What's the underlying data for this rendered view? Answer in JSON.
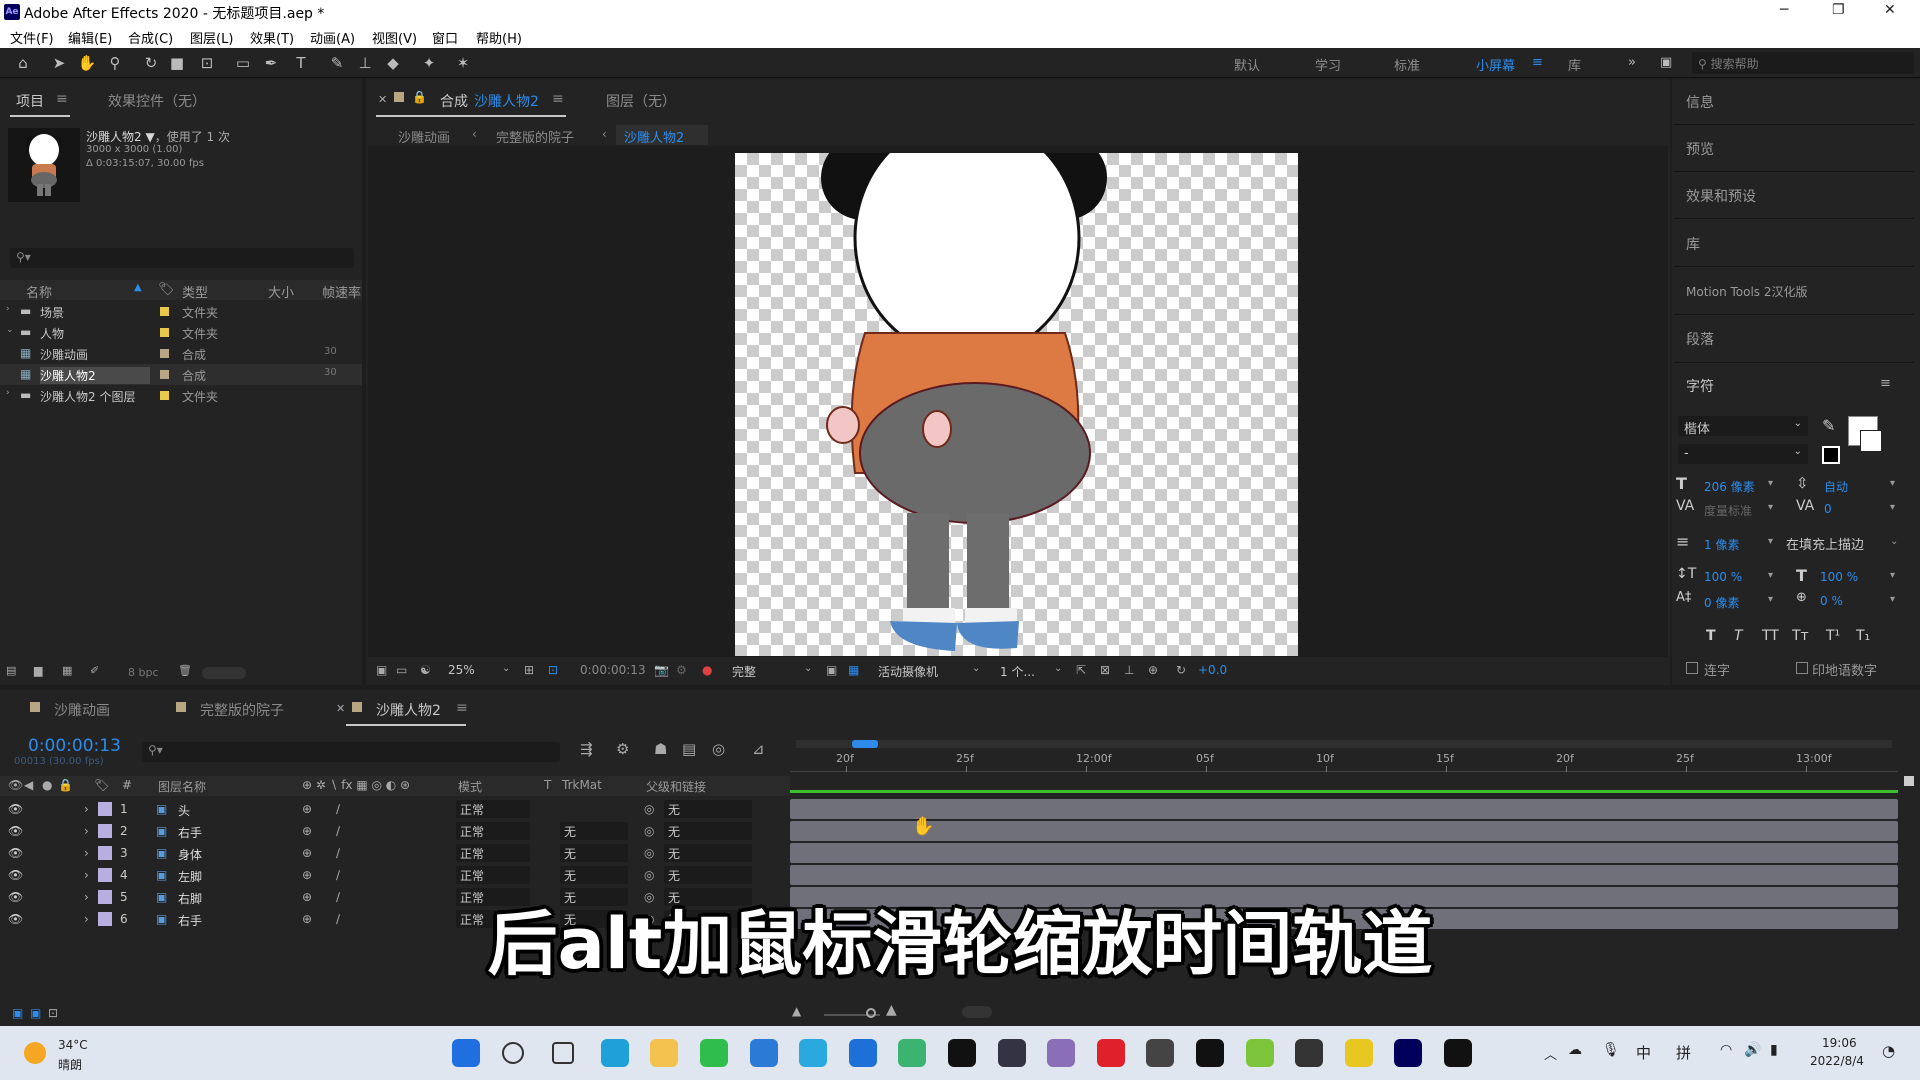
{
  "window": {
    "title": "Adobe After Effects 2020 - 无标题项目.aep *",
    "logo": "Ae"
  },
  "menu": [
    "文件(F)",
    "编辑(E)",
    "合成(C)",
    "图层(L)",
    "效果(T)",
    "动画(A)",
    "视图(V)",
    "窗口",
    "帮助(H)"
  ],
  "workspaces": {
    "items": [
      "默认",
      "学习",
      "标准",
      "小屏幕",
      "库"
    ],
    "active": "小屏幕"
  },
  "search_help": {
    "placeholder": "搜索帮助"
  },
  "project_panel": {
    "tab_project": "项目",
    "tab_effects": "效果控件（无）",
    "selected_name": "沙雕人物2",
    "selected_usage": "，使用了 1 次",
    "selected_dims": "3000 x 3000 (1.00)",
    "selected_duration": "Δ 0:03:15:07, 30.00 fps",
    "columns": {
      "name": "名称",
      "type": "类型",
      "size": "大小",
      "rate": "帧速率"
    },
    "items": [
      {
        "name": "场景",
        "type": "文件夹",
        "rate": "",
        "kind": "folder",
        "tag": "#e8c94a",
        "expanded": false
      },
      {
        "name": "人物",
        "type": "文件夹",
        "rate": "",
        "kind": "folder",
        "tag": "#e8c94a",
        "expanded": true
      },
      {
        "name": "沙雕动画",
        "type": "合成",
        "rate": "30",
        "kind": "comp",
        "tag": "#b7a584",
        "expanded": false
      },
      {
        "name": "沙雕人物2",
        "type": "合成",
        "rate": "30",
        "kind": "comp",
        "tag": "#b7a584",
        "expanded": false,
        "selected": true
      },
      {
        "name": "沙雕人物2 个图层",
        "type": "文件夹",
        "rate": "",
        "kind": "folder",
        "tag": "#e8c94a",
        "expanded": false
      }
    ],
    "bpc": "8 bpc"
  },
  "comp_panel": {
    "tab_label": "合成",
    "tab_name": "沙雕人物2",
    "layer_tab": "图层（无）",
    "breadcrumbs": [
      "沙雕动画",
      "完整版的院子",
      "沙雕人物2"
    ],
    "zoom": "25%",
    "timecode": "0:00:00:13",
    "quality": "完整",
    "camera": "活动摄像机",
    "views": "1 个...",
    "exposure": "+0.0"
  },
  "right_panel": {
    "items": [
      "信息",
      "预览",
      "效果和预设",
      "库",
      "Motion Tools 2汉化版",
      "段落"
    ],
    "character_title": "字符",
    "font": "楷体",
    "font_style": "-",
    "font_size": "206 像素",
    "leading": "自动",
    "kerning": "度量标准",
    "tracking": "0",
    "stroke_width": "1 像素",
    "stroke_type": "在填充上描边",
    "vert_scale": "100 %",
    "horiz_scale": "100 %",
    "baseline": "0 像素",
    "tsume": "0 %",
    "ligatures": "连字",
    "hindi_digits": "印地语数字"
  },
  "timeline": {
    "tabs": [
      {
        "name": "沙雕动画",
        "tag": "#b7a584"
      },
      {
        "name": "完整版的院子",
        "tag": "#b7a584"
      },
      {
        "name": "沙雕人物2",
        "tag": "#b7a584",
        "active": true
      }
    ],
    "current_time": "0:00:00:13",
    "frame_info": "00013 (30.00 fps)",
    "columns": {
      "layer_name": "图层名称",
      "mode": "模式",
      "t": "T",
      "trkmat": "TrkMat",
      "parent": "父级和链接"
    },
    "ruler": [
      "20f",
      "25f",
      "12:00f",
      "05f",
      "10f",
      "15f",
      "20f",
      "25f",
      "13:00f"
    ],
    "layers": [
      {
        "num": "1",
        "name": "头",
        "mode": "正常",
        "trkmat": "",
        "parent": "无"
      },
      {
        "num": "2",
        "name": "右手",
        "mode": "正常",
        "trkmat": "无",
        "parent": "无"
      },
      {
        "num": "3",
        "name": "身体",
        "mode": "正常",
        "trkmat": "无",
        "parent": "无"
      },
      {
        "num": "4",
        "name": "左脚",
        "mode": "正常",
        "trkmat": "无",
        "parent": "无"
      },
      {
        "num": "5",
        "name": "右脚",
        "mode": "正常",
        "trkmat": "无",
        "parent": "无"
      },
      {
        "num": "6",
        "name": "右手",
        "mode": "正常",
        "trkmat": "无",
        "parent": "无"
      }
    ]
  },
  "subtitle": "后alt加鼠标滑轮缩放时间轨道",
  "taskbar": {
    "weather_temp": "34°C",
    "weather_desc": "晴朗",
    "ime_lang": "中",
    "ime_mode": "拼",
    "time": "19:06",
    "date": "2022/8/4"
  }
}
